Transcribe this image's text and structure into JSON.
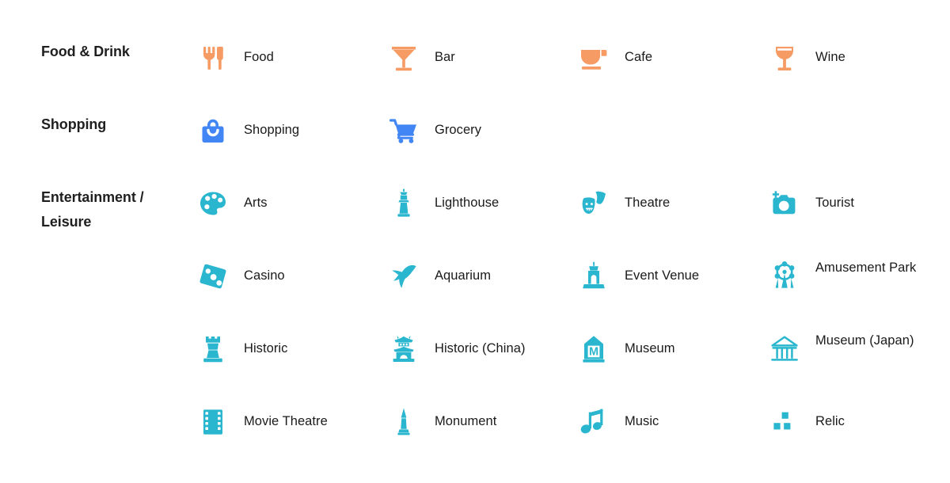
{
  "sheet": {
    "background": "#ffffff",
    "title_color": "#1f1f1f",
    "label_color": "#1a1a1a"
  },
  "palette": {
    "food_drink": "#F59B63",
    "shopping": "#4285F4",
    "entertainment_leisure": "#29B6CE"
  },
  "categories": [
    {
      "id": "food-drink",
      "title": "Food & Drink",
      "color": "#F59B63",
      "rows": [
        [
          {
            "label": "Food",
            "icon": "fork-knife-icon"
          },
          {
            "label": "Bar",
            "icon": "martini-glass-icon"
          },
          {
            "label": "Cafe",
            "icon": "coffee-cup-icon"
          },
          {
            "label": "Wine",
            "icon": "wine-glass-icon"
          }
        ]
      ]
    },
    {
      "id": "shopping",
      "title": "Shopping",
      "color": "#4285F4",
      "rows": [
        [
          {
            "label": "Shopping",
            "icon": "shopping-bag-icon"
          },
          {
            "label": "Grocery",
            "icon": "shopping-cart-icon"
          }
        ]
      ]
    },
    {
      "id": "entertainment-leisure",
      "title": "Entertainment / Leisure",
      "color": "#29B6CE",
      "rows": [
        [
          {
            "label": "Arts",
            "icon": "paint-palette-icon"
          },
          {
            "label": "Lighthouse",
            "icon": "lighthouse-icon"
          },
          {
            "label": "Theatre",
            "icon": "theatre-masks-icon"
          },
          {
            "label": "Tourist",
            "icon": "camera-icon"
          }
        ],
        [
          {
            "label": "Casino",
            "icon": "dice-icon"
          },
          {
            "label": "Aquarium",
            "icon": "dolphin-icon"
          },
          {
            "label": "Event Venue",
            "icon": "event-venue-icon"
          },
          {
            "label": "Amusement Park",
            "icon": "ferris-wheel-icon"
          }
        ],
        [
          {
            "label": "Historic",
            "icon": "castle-tower-icon"
          },
          {
            "label": "Historic (China)",
            "icon": "pagoda-gate-icon"
          },
          {
            "label": "Museum",
            "icon": "museum-m-icon"
          },
          {
            "label": "Museum (Japan)",
            "icon": "classical-building-icon"
          }
        ],
        [
          {
            "label": "Movie Theatre",
            "icon": "film-strip-icon"
          },
          {
            "label": "Monument",
            "icon": "obelisk-icon"
          },
          {
            "label": "Music",
            "icon": "music-note-icon"
          },
          {
            "label": "Relic",
            "icon": "relic-blocks-icon"
          }
        ]
      ]
    }
  ]
}
